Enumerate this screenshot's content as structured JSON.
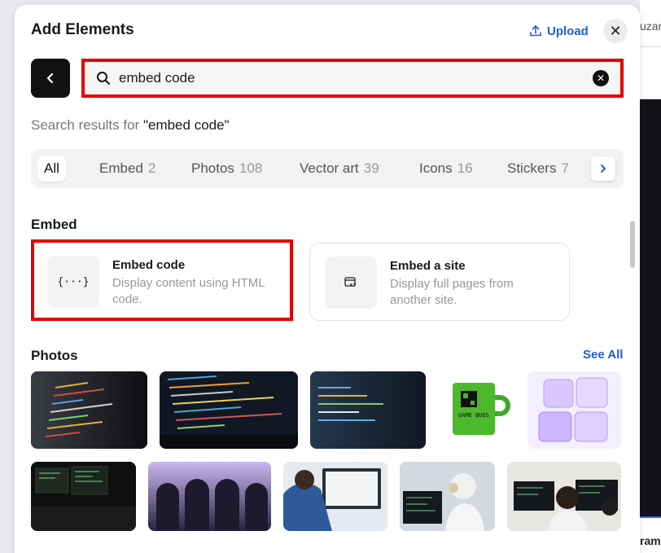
{
  "background": {
    "top_text": "uzam",
    "bottom_text": "ram"
  },
  "header": {
    "title": "Add Elements",
    "upload_label": "Upload",
    "close_glyph": "✕"
  },
  "search": {
    "value": "embed code",
    "clear_glyph": "✕"
  },
  "results": {
    "prefix": "Search results for ",
    "query": "\"embed code\""
  },
  "tabs": [
    {
      "label": "All",
      "count": ""
    },
    {
      "label": "Embed",
      "count": "2"
    },
    {
      "label": "Photos",
      "count": "108"
    },
    {
      "label": "Vector art",
      "count": "39"
    },
    {
      "label": "Icons",
      "count": "16"
    },
    {
      "label": "Stickers",
      "count": "7"
    }
  ],
  "embed_section": {
    "title": "Embed",
    "cards": [
      {
        "title": "Embed code",
        "description": "Display content using HTML code.",
        "icon": "{···}"
      },
      {
        "title": "Embed a site",
        "description": "Display full pages from another site."
      }
    ]
  },
  "photos_section": {
    "title": "Photos",
    "see_all": "See All",
    "mug_caption": "GAME BUGS"
  },
  "colors": {
    "accent": "#1f5ce0",
    "highlight": "#e30000"
  }
}
